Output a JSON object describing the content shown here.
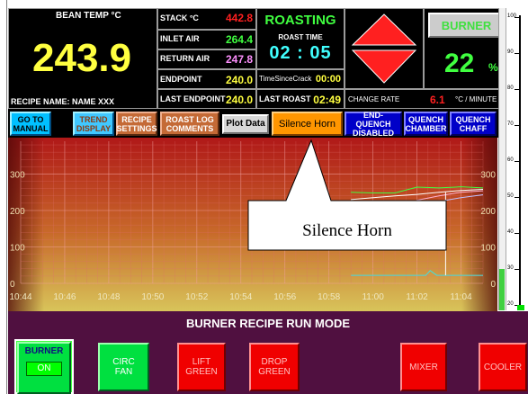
{
  "readouts": {
    "bean_temp_label": "BEAN TEMP °C",
    "bean_temp_value": "243.9",
    "recipe_name": "RECIPE NAME: NAME XXX",
    "stack_label": "STACK °C",
    "stack_value": "442.8",
    "inlet_label": "INLET AIR",
    "inlet_value": "264.4",
    "return_label": "RETURN AIR",
    "return_value": "247.8",
    "endpoint_label": "ENDPOINT",
    "endpoint_value": "240.0",
    "last_endpoint_label": "LAST ENDPOINT",
    "last_endpoint_value": "240.0",
    "status": "ROASTING",
    "roast_time_label": "ROAST TIME",
    "roast_time_value": "02 : 05",
    "tsc_label": "TimeSinceCrack",
    "tsc_value": "00:00",
    "last_roast_label": "LAST ROAST",
    "last_roast_value": "02:49",
    "burner_label": "BURNER",
    "burner_value": "22",
    "burner_unit": "%",
    "change_rate_label": "CHANGE RATE",
    "change_rate_value": "6.1",
    "change_rate_unit": "°C / MINUTE"
  },
  "buttons": {
    "goto_manual": "GO TO\nMANUAL",
    "trend_display": "TREND\nDISPLAY",
    "recipe_settings": "RECIPE\nSETTINGS",
    "roast_log": "ROAST LOG\nCOMMENTS",
    "plot_data": "Plot Data",
    "silence_horn": "Silence Horn",
    "end_quench": "END-QUENCH\nDISABLED",
    "quench_chamber": "QUENCH\nCHAMBER",
    "quench_chaff": "QUENCH\nCHAFF"
  },
  "callout": {
    "text": "Silence Horn"
  },
  "mode": {
    "title": "BURNER RECIPE RUN MODE"
  },
  "bottom_buttons": {
    "burner": "BURNER",
    "burner_state": "ON",
    "circ_fan": "CIRC\nFAN",
    "lift_green": "LIFT\nGREEN",
    "drop_green": "DROP\nGREEN",
    "mixer": "MIXER",
    "cooler": "COOLER"
  },
  "scale": {
    "ticks": [
      "100",
      "90",
      "80",
      "70",
      "60",
      "50",
      "40",
      "30",
      "20"
    ]
  },
  "chart_data": {
    "type": "line",
    "x_ticks": [
      "10:44",
      "10:46",
      "10:48",
      "10:50",
      "10:52",
      "10:54",
      "10:56",
      "10:58",
      "11:00",
      "11:02",
      "11:04"
    ],
    "y_ticks": [
      0,
      100,
      200,
      300
    ],
    "ylim": [
      0,
      390
    ],
    "xlim_minutes": [
      0,
      21
    ],
    "grid": true,
    "series": [
      {
        "color": "#40ff40",
        "x": [
          15.0,
          16.0,
          17.0,
          18.0,
          19.0,
          20.0,
          21.0
        ],
        "y": [
          250,
          248,
          248,
          264,
          262,
          265,
          262
        ]
      },
      {
        "color": "#ffb0d0",
        "x": [
          15.0,
          16.0,
          17.0,
          18.0,
          19.0,
          20.0,
          21.0
        ],
        "y": [
          195,
          205,
          208,
          228,
          240,
          250,
          254
        ]
      },
      {
        "color": "#ffffff",
        "x": [
          15.0,
          16.0,
          17.0,
          18.0,
          19.0,
          20.0,
          21.0
        ],
        "y": [
          230,
          235,
          240,
          244,
          250,
          255,
          258
        ]
      },
      {
        "color": "#c0c0ff",
        "x": [
          15.0,
          16.0,
          17.0,
          18.0,
          19.0,
          20.0,
          21.0
        ],
        "y": [
          185,
          195,
          205,
          215,
          225,
          235,
          243
        ]
      },
      {
        "color": "#40e0e0",
        "x": [
          15.0,
          16.5,
          17.5,
          18.4,
          18.6,
          18.9,
          19.3,
          21.0
        ],
        "y": [
          22,
          22,
          22,
          22,
          35,
          22,
          22,
          22
        ]
      }
    ]
  }
}
